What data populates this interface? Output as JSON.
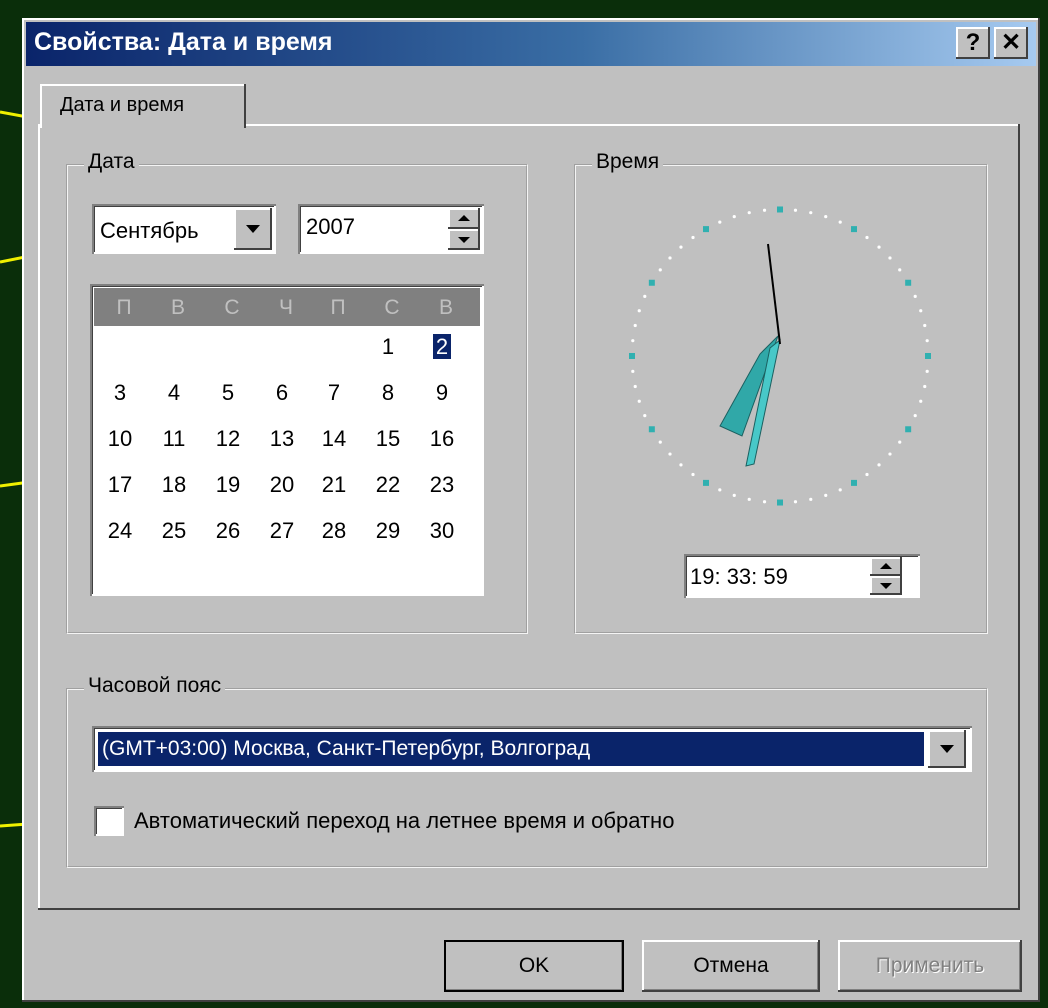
{
  "window": {
    "title": "Свойства: Дата и время",
    "help_label": "?",
    "close_label": "✕"
  },
  "tab": {
    "label": "Дата и время"
  },
  "date_group": {
    "label": "Дата",
    "month": "Сентябрь",
    "year": "2007",
    "days_of_week": [
      "П",
      "В",
      "С",
      "Ч",
      "П",
      "С",
      "В"
    ],
    "weeks": [
      [
        "",
        "",
        "",
        "",
        "",
        "1",
        "2"
      ],
      [
        "3",
        "4",
        "5",
        "6",
        "7",
        "8",
        "9"
      ],
      [
        "10",
        "11",
        "12",
        "13",
        "14",
        "15",
        "16"
      ],
      [
        "17",
        "18",
        "19",
        "20",
        "21",
        "22",
        "23"
      ],
      [
        "24",
        "25",
        "26",
        "27",
        "28",
        "29",
        "30"
      ]
    ],
    "selected_day": "2"
  },
  "time_group": {
    "label": "Время",
    "time": "19: 33: 59"
  },
  "timezone_group": {
    "label": "Часовой пояс",
    "selected": "(GMT+03:00) Москва, Санкт-Петербург, Волгоград",
    "dst_label": "Автоматический переход на летнее время и обратно",
    "dst_checked": false
  },
  "buttons": {
    "ok": "OK",
    "cancel": "Отмена",
    "apply": "Применить"
  },
  "colors": {
    "background": "#0a2e0a",
    "dialog": "#c0c0c0",
    "titlebar": "#0a246a",
    "callout": "#f0f000",
    "clock_dots": "#30b0b0"
  }
}
